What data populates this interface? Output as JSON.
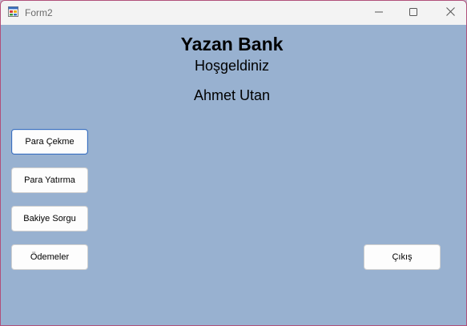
{
  "window": {
    "title": "Form2",
    "icon": "winforms-app-icon"
  },
  "caption_buttons": {
    "minimize_icon": "minimize-icon",
    "maximize_icon": "maximize-icon",
    "close_icon": "close-icon"
  },
  "content": {
    "bank_name": "Yazan Bank",
    "welcome": "Hoşgeldiniz",
    "user_name": "Ahmet Utan"
  },
  "buttons": {
    "withdraw": "Para Çekme",
    "deposit": "Para Yatırma",
    "balance": "Bakiye Sorgu",
    "payments": "Ödemeler",
    "exit": "Çıkış"
  },
  "colors": {
    "form_background": "#98b1d0",
    "titlebar_background": "#f3f3f3",
    "focus_border": "#3a6fbf"
  }
}
